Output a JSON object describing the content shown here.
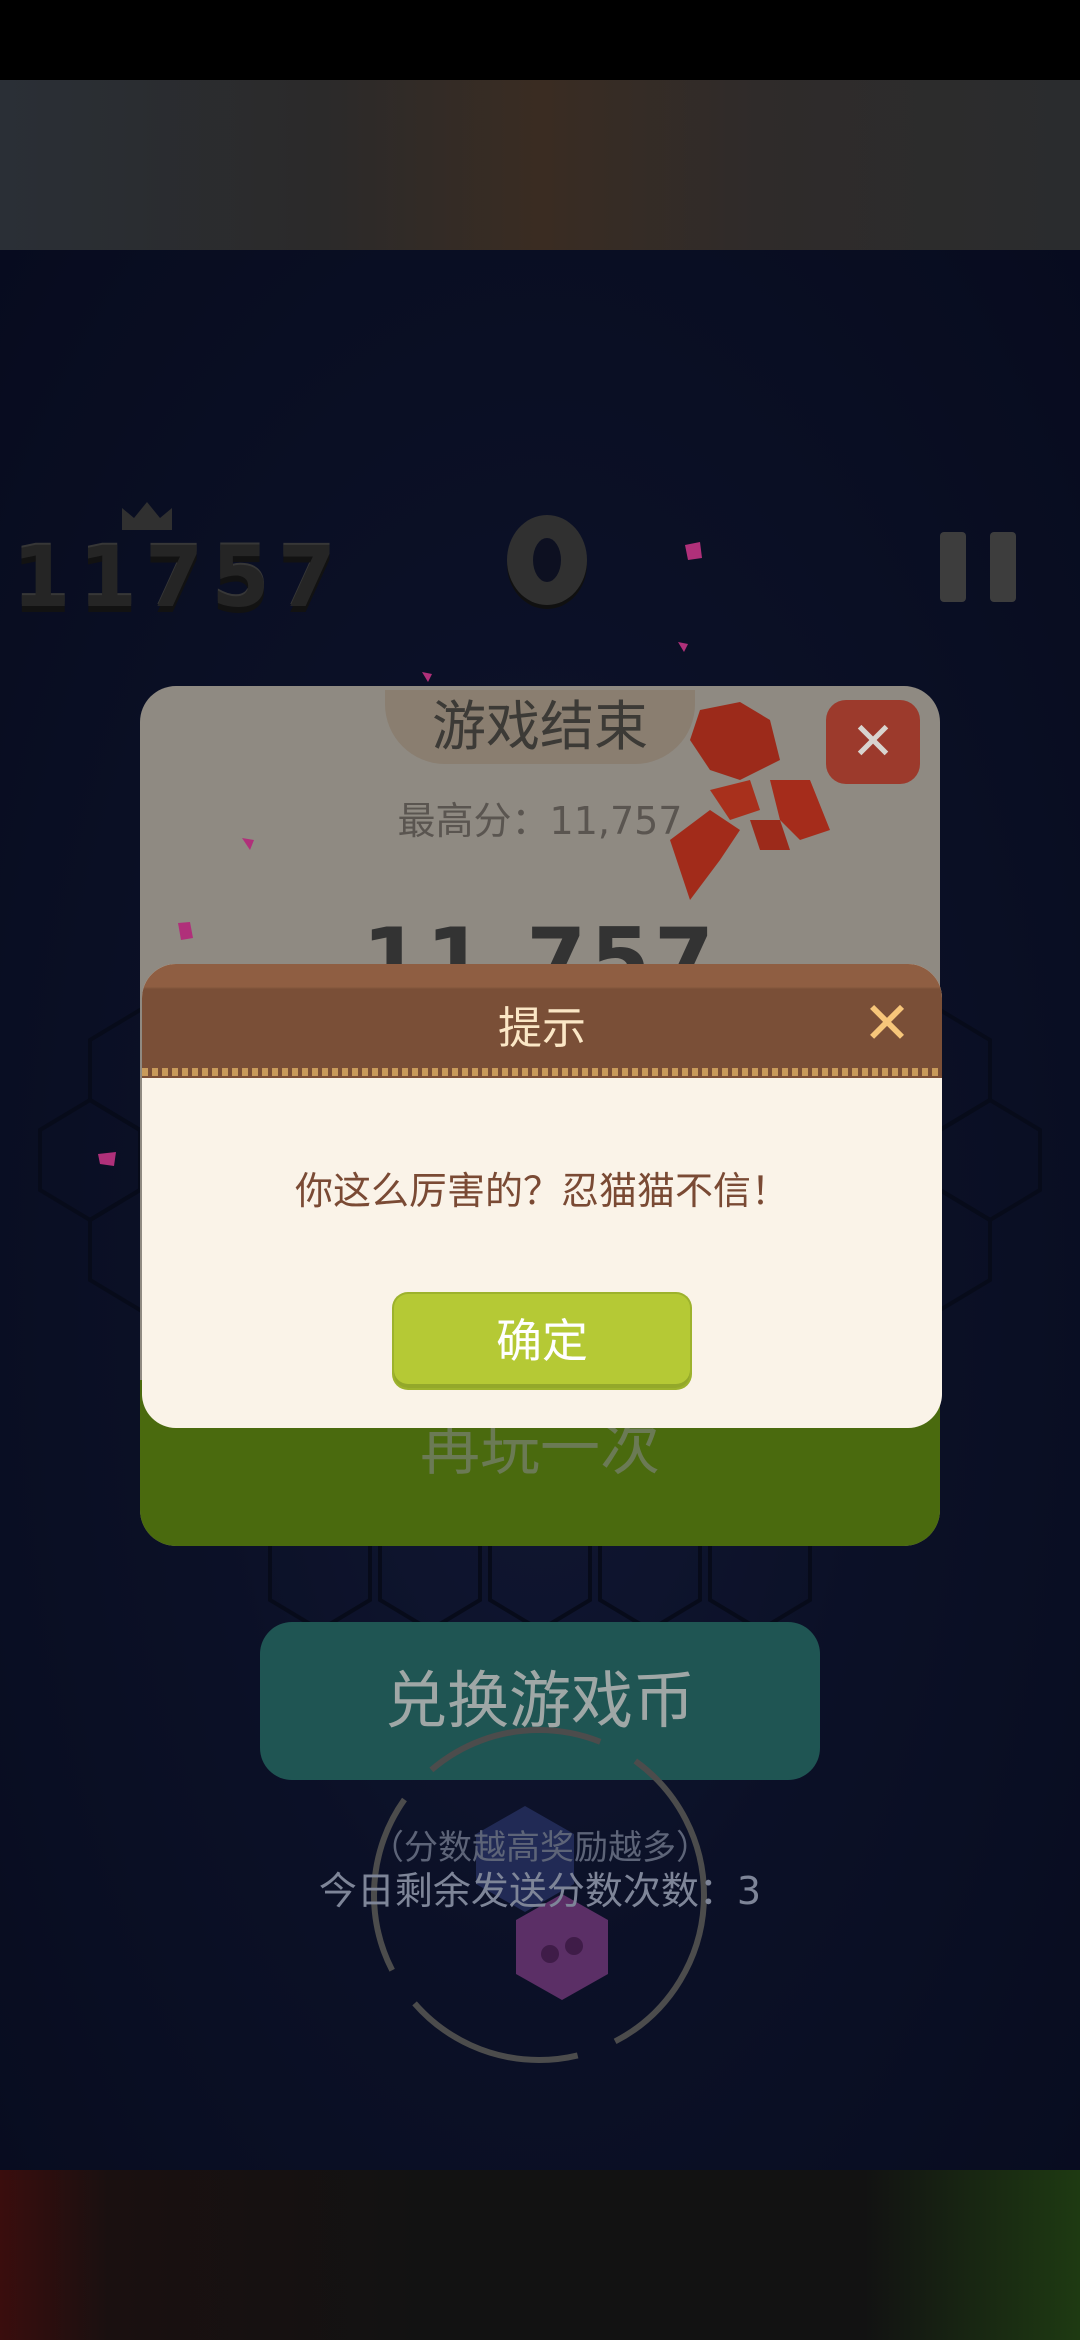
{
  "hud": {
    "best_score": "11757",
    "current_score": "0"
  },
  "game_over": {
    "title": "游戏结束",
    "best_label": "最高分：11,757",
    "score": "11,757",
    "replay_label": "再玩一次"
  },
  "exchange": {
    "button_label": "兑换游戏币",
    "hint_more_reward": "（分数越高奖励越多）",
    "hint_remaining": "今日剩余发送分数次数：3"
  },
  "dialog": {
    "title": "提示",
    "message": "你这么厉害的？忍猫猫不信！",
    "ok_label": "确定"
  },
  "colors": {
    "dialog_header": "#7a4f37",
    "ok_button": "#b5c935",
    "exchange_button": "#1f5553",
    "close_button": "#9c3a2c"
  }
}
